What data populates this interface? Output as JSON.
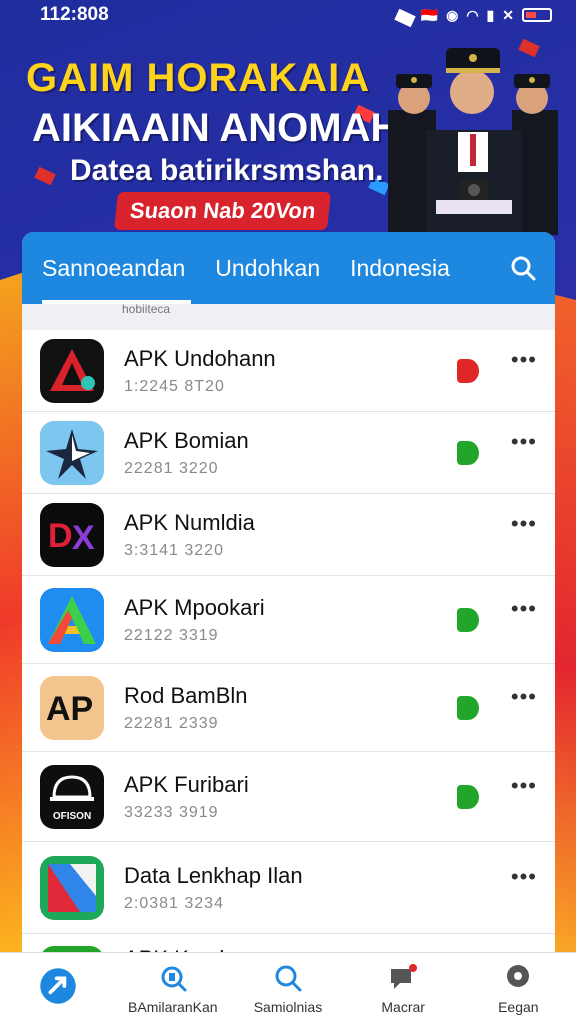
{
  "status_bar": {
    "time": "112:808"
  },
  "hero": {
    "title_line1": "GAIM HORAKAIA",
    "title_line2": "AIKIAAIN ANOMAH",
    "title_line3": "Datea batirikrsmshan.",
    "badge": "Suaon Nab 20Von"
  },
  "tabs": [
    {
      "label": "Sannoeandan",
      "active": true
    },
    {
      "label": "Undohkan",
      "active": false
    },
    {
      "label": "Indonesia",
      "active": false
    }
  ],
  "subheader": "hobiiteca",
  "apps": [
    {
      "name": "APK Undohann",
      "meta": "1:2245 8T20",
      "icon": "game-logo-icon",
      "status": "red"
    },
    {
      "name": "APK Bomian",
      "meta": "22281 3220",
      "icon": "star-blade-icon",
      "status": "green"
    },
    {
      "name": "APK Numldia",
      "meta": "3:3141 3220",
      "icon": "dx-logo-icon",
      "status": "none"
    },
    {
      "name": "APK Mpookari",
      "meta": "22122 3319",
      "icon": "a-logo-icon",
      "status": "green"
    },
    {
      "name": "Rod BamBln",
      "meta": "22281 2339",
      "icon": "ap-logo-icon",
      "status": "green"
    },
    {
      "name": "APK Furibari",
      "meta": "33233 3919",
      "icon": "hat-logo-icon",
      "status": "green"
    },
    {
      "name": "Data Lenkhap Ilan",
      "meta": "2:0381 3234",
      "icon": "map-logo-icon",
      "status": "none"
    },
    {
      "name": "APK Kmakar",
      "meta": "",
      "icon": "green-app-icon",
      "status": "none"
    }
  ],
  "icon_badge_text": {
    "hat_logo": "OFISON"
  },
  "bottom_nav": [
    {
      "label": "",
      "icon": "home-icon"
    },
    {
      "label": "BAmilaranKan",
      "icon": "search-doc-icon"
    },
    {
      "label": "Samiolnias",
      "icon": "search-icon"
    },
    {
      "label": "Macrar",
      "icon": "chat-icon"
    },
    {
      "label": "Eegan",
      "icon": "location-icon"
    }
  ],
  "colors": {
    "accent_blue": "#1e88e0",
    "status_red": "#e02626",
    "status_green": "#22a52a",
    "hero_yellow": "#ffd21c",
    "badge_red": "#d8222c"
  }
}
